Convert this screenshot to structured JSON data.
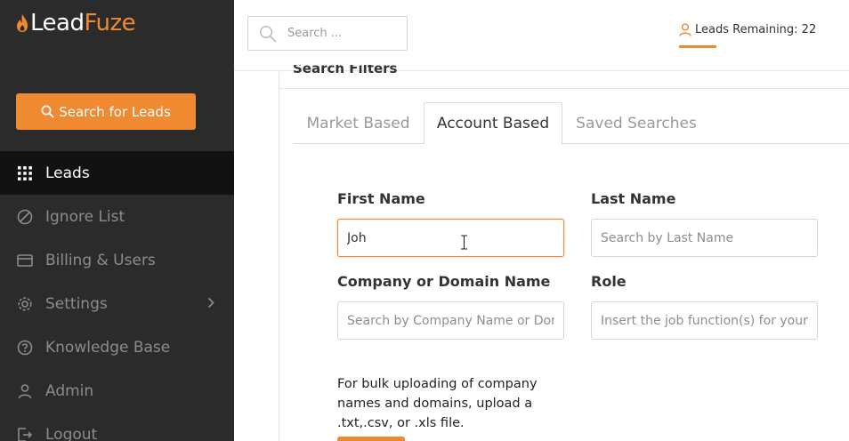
{
  "brand": {
    "name_part1": "Lead",
    "name_part2": "Fuze",
    "accent_color": "#ef8a32"
  },
  "sidebar": {
    "search_button_label": "Search for Leads",
    "items": [
      {
        "label": "Leads",
        "icon": "grid-icon",
        "active": true
      },
      {
        "label": "Ignore List",
        "icon": "block-icon"
      },
      {
        "label": "Billing & Users",
        "icon": "wallet-icon"
      },
      {
        "label": "Settings",
        "icon": "gear-icon",
        "has_submenu": true
      },
      {
        "label": "Knowledge Base",
        "icon": "question-icon"
      },
      {
        "label": "Admin",
        "icon": "user-icon"
      },
      {
        "label": "Logout",
        "icon": "logout-icon"
      }
    ]
  },
  "topbar": {
    "search_placeholder": "Search ...",
    "leads_remaining_label": "Leads Remaining: 22"
  },
  "filters": {
    "title": "Search Filters",
    "tabs": [
      {
        "label": "Market Based"
      },
      {
        "label": "Account Based",
        "active": true
      },
      {
        "label": "Saved Searches"
      }
    ]
  },
  "form": {
    "first_name": {
      "label": "First Name",
      "value": "Joh",
      "placeholder": ""
    },
    "last_name": {
      "label": "Last Name",
      "placeholder": "Search by Last Name"
    },
    "company": {
      "label": "Company or Domain Name",
      "placeholder": "Search by Company Name or Domain"
    },
    "role": {
      "label": "Role",
      "placeholder": "Insert the job function(s) for your target"
    },
    "bulk_text": "For bulk uploading of company names and domains, upload a .txt,.csv, or .xls file."
  }
}
